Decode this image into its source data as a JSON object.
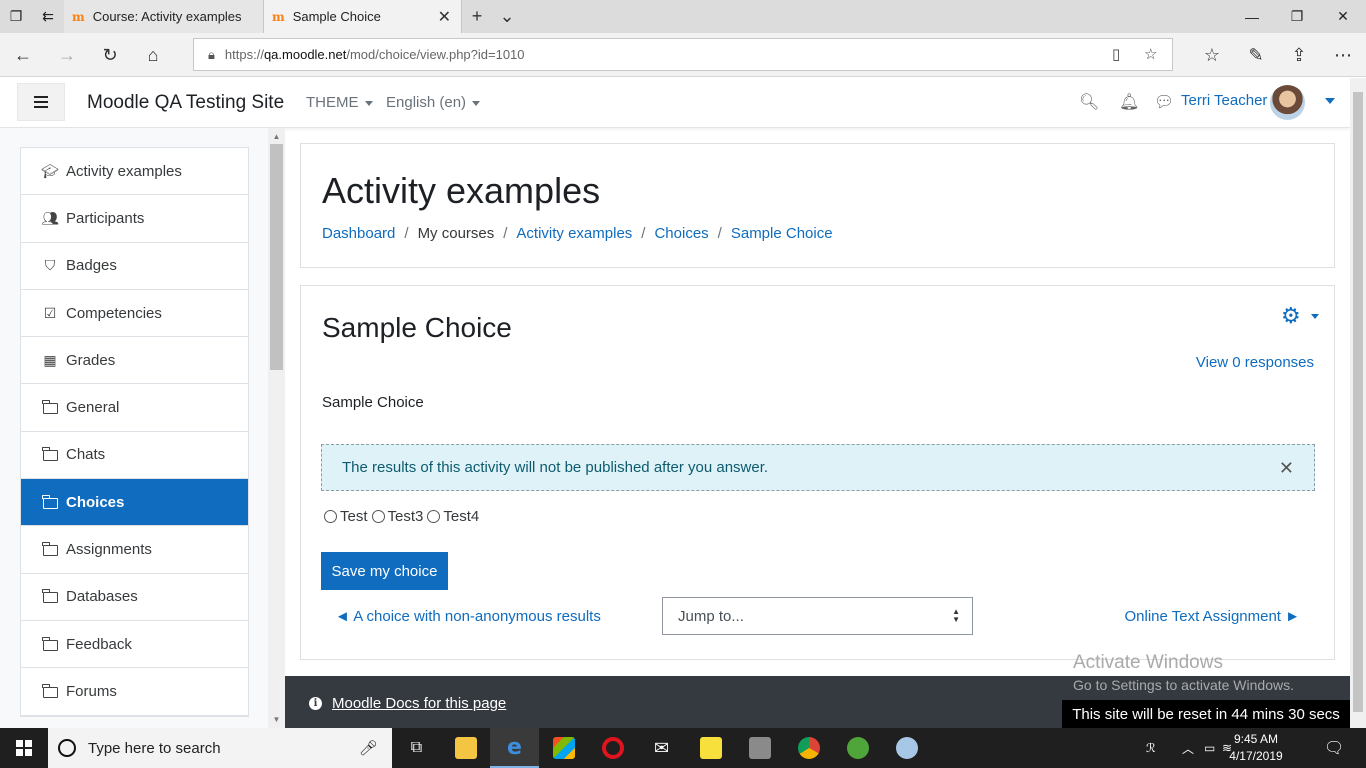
{
  "browser": {
    "tabs": [
      {
        "title": "Course: Activity examples",
        "favicon": "m"
      },
      {
        "title": "Sample Choice",
        "favicon": "m"
      }
    ],
    "url_host": "qa.moodle.net",
    "url_prefix": "https://",
    "url_path": "/mod/choice/view.php?id=1010"
  },
  "navbar": {
    "site_name": "Moodle QA Testing Site",
    "theme_label": "THEME",
    "language_label": "English ‎(en)‎",
    "user_name": "Terri Teacher"
  },
  "drawer": {
    "items": [
      {
        "label": "Activity examples",
        "icon": "graduation-cap-icon"
      },
      {
        "label": "Participants",
        "icon": "users-icon"
      },
      {
        "label": "Badges",
        "icon": "shield-icon"
      },
      {
        "label": "Competencies",
        "icon": "checkbox-icon"
      },
      {
        "label": "Grades",
        "icon": "table-icon"
      },
      {
        "label": "General",
        "icon": "folder-icon"
      },
      {
        "label": "Chats",
        "icon": "folder-icon"
      },
      {
        "label": "Choices",
        "icon": "folder-icon",
        "active": true
      },
      {
        "label": "Assignments",
        "icon": "folder-icon"
      },
      {
        "label": "Databases",
        "icon": "folder-icon"
      },
      {
        "label": "Feedback",
        "icon": "folder-icon"
      },
      {
        "label": "Forums",
        "icon": "folder-icon"
      }
    ]
  },
  "header": {
    "title": "Activity examples",
    "breadcrumb": [
      {
        "label": "Dashboard",
        "link": true
      },
      {
        "label": "My courses",
        "link": false
      },
      {
        "label": "Activity examples",
        "link": true
      },
      {
        "label": "Choices",
        "link": true
      },
      {
        "label": "Sample Choice",
        "link": true
      }
    ]
  },
  "main": {
    "title": "Sample Choice",
    "view_responses": "View 0 responses",
    "intro": "Sample Choice",
    "alert": "The results of this activity will not be published after you answer.",
    "options": [
      "Test",
      "Test3",
      "Test4"
    ],
    "save_label": "Save my choice",
    "prev_link": "A choice with non-anonymous results",
    "jump_placeholder": "Jump to...",
    "next_link": "Online Text Assignment"
  },
  "footer": {
    "docs_link": "Moodle Docs for this page",
    "reset_notice": "This site will be reset in 44 mins 30 secs"
  },
  "watermark": {
    "line1": "Activate Windows",
    "line2": "Go to Settings to activate Windows."
  },
  "taskbar": {
    "search_placeholder": "Type here to search",
    "time": "9:45 AM",
    "date": "4/17/2019"
  },
  "colors": {
    "accent": "#0f6cbf",
    "footer_bg": "#343a40",
    "alert_bg": "#def2f8"
  }
}
